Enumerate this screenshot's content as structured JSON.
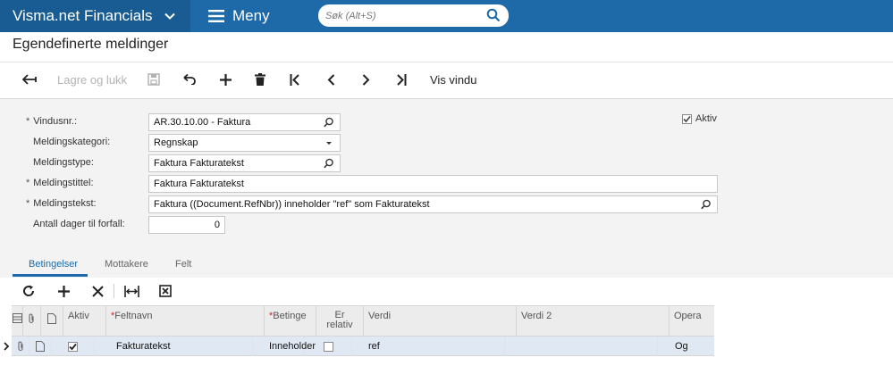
{
  "app": {
    "title": "Visma.net Financials",
    "menu_label": "Meny",
    "search_placeholder": "Søk (Alt+S)"
  },
  "page": {
    "title": "Egendefinerte meldinger"
  },
  "toolbar": {
    "save_close_label": "Lagre og lukk",
    "show_window_label": "Vis vindu"
  },
  "form": {
    "window_no": {
      "label": "Vindusnr.:",
      "value": "AR.30.10.00 - Faktura"
    },
    "category": {
      "label": "Meldingskategori:",
      "value": "Regnskap"
    },
    "type": {
      "label": "Meldingstype:",
      "value": "Faktura Fakturatekst"
    },
    "msg_title": {
      "label": "Meldingstittel:",
      "value": "Faktura Fakturatekst"
    },
    "msg_text": {
      "label": "Meldingstekst:",
      "value": "Faktura ((Document.RefNbr)) inneholder \"ref\" som Fakturatekst"
    },
    "days_due": {
      "label": "Antall dager til forfall:",
      "value": "0"
    },
    "active": {
      "label": "Aktiv",
      "checked": true
    }
  },
  "tabs": [
    "Betingelser",
    "Mottakere",
    "Felt"
  ],
  "grid": {
    "columns": {
      "aktiv": "Aktiv",
      "feltnavn": "Feltnavn",
      "betingelse": "Beting⁠e",
      "er_relativ_1": "Er",
      "er_relativ_2": "relativ",
      "verdi": "Verdi",
      "verdi2": "Verdi 2",
      "operator": "Opera"
    },
    "rows": [
      {
        "aktiv": true,
        "feltnavn": "Fakturatekst",
        "betingelse": "Inneholder",
        "er_relativ": false,
        "verdi": "ref",
        "verdi2": "",
        "operator": "Og"
      }
    ]
  },
  "colors": {
    "topbar": "#1e6aa8",
    "brand": "#185c93",
    "accent": "#1e6aa8",
    "selected_row": "#e0e9f3"
  }
}
